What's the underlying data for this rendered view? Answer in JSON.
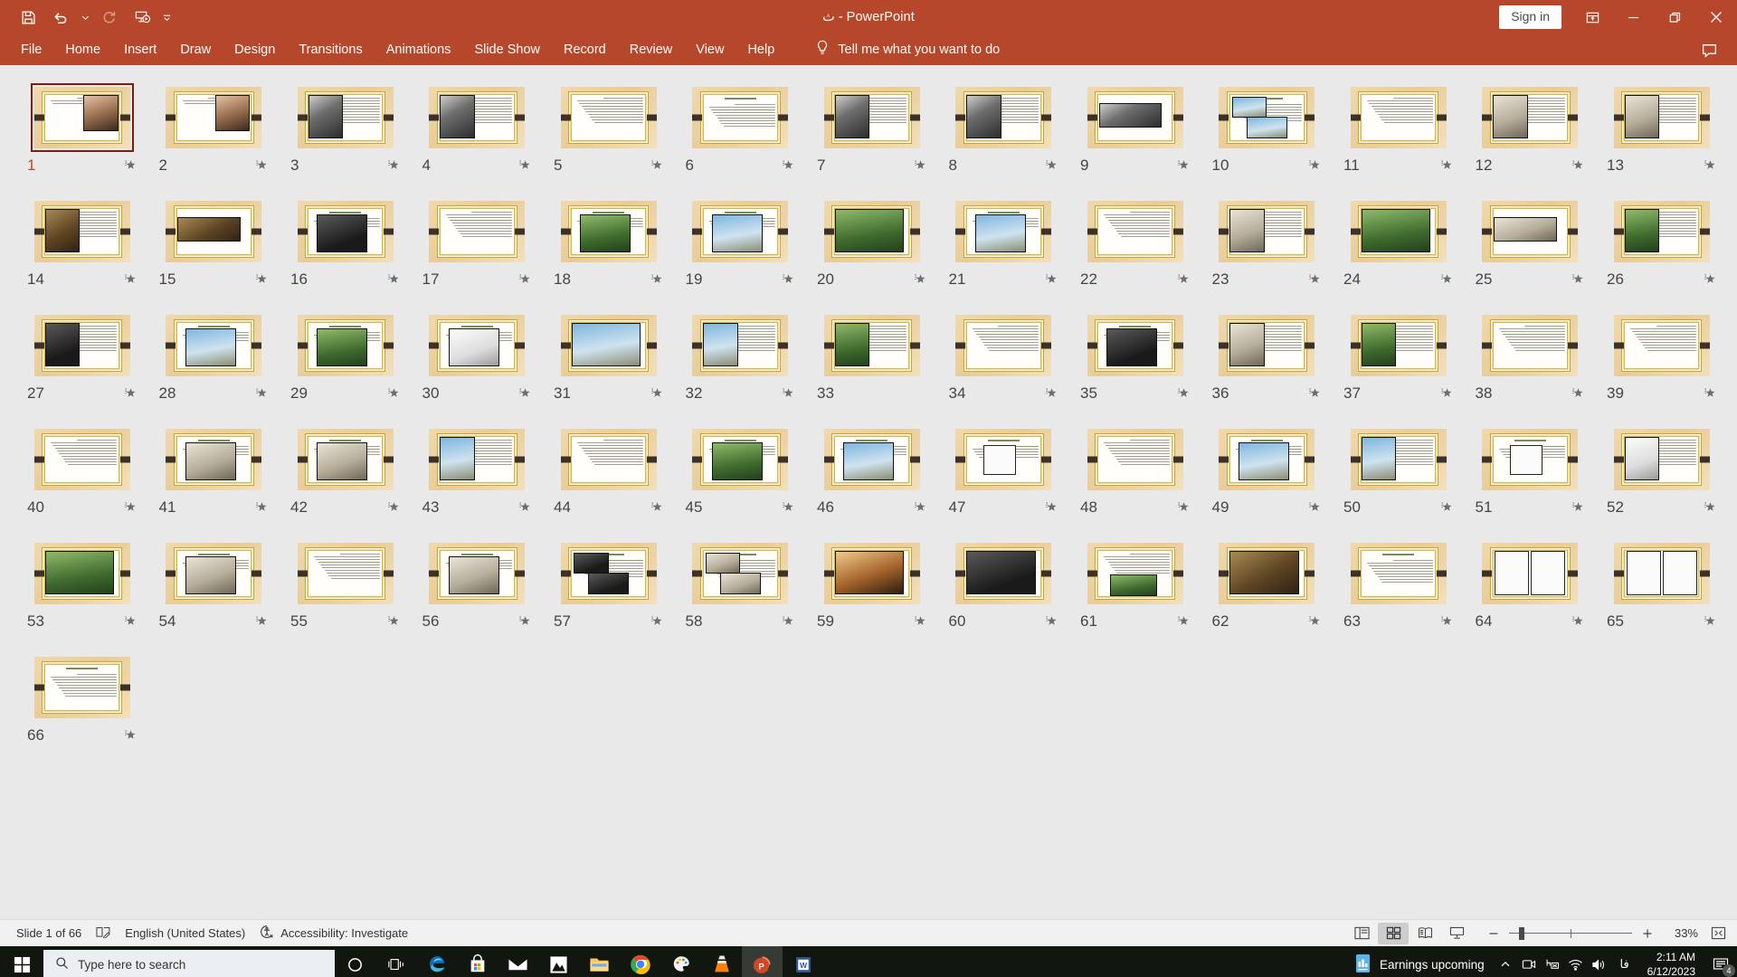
{
  "titlebar": {
    "title": "ث  -  PowerPoint",
    "signin_label": "Sign in",
    "quick_access": [
      {
        "name": "save-icon",
        "label": "Save"
      },
      {
        "name": "undo-icon",
        "label": "Undo"
      },
      {
        "name": "undo-dropdown-caret-icon",
        "label": "Undo options"
      },
      {
        "name": "redo-icon",
        "label": "Redo"
      },
      {
        "name": "start-presentation-icon",
        "label": "Start From Beginning"
      },
      {
        "name": "customize-quick-access-toolbar-icon",
        "label": "Customize Quick Access Toolbar"
      }
    ],
    "window_controls": [
      {
        "name": "ribbon-display-options-icon",
        "label": "Ribbon Display Options"
      },
      {
        "name": "minimize-icon",
        "label": "Minimize"
      },
      {
        "name": "restore-icon",
        "label": "Restore Down"
      },
      {
        "name": "close-icon",
        "label": "Close"
      }
    ]
  },
  "ribbon": {
    "tabs": [
      {
        "label": "File"
      },
      {
        "label": "Home"
      },
      {
        "label": "Insert"
      },
      {
        "label": "Draw"
      },
      {
        "label": "Design"
      },
      {
        "label": "Transitions"
      },
      {
        "label": "Animations"
      },
      {
        "label": "Slide Show"
      },
      {
        "label": "Record"
      },
      {
        "label": "Review"
      },
      {
        "label": "View"
      },
      {
        "label": "Help"
      }
    ],
    "tellme_label": "Tell me what you want to do",
    "comments_label": "Comments"
  },
  "statusbar": {
    "slide_counter": "Slide 1 of 66",
    "notes_label": "Notes",
    "language": "English (United States)",
    "accessibility": "Accessibility: Investigate",
    "views": [
      {
        "name": "normal-view-button",
        "label": "Normal",
        "active": false
      },
      {
        "name": "slide-sorter-view-button",
        "label": "Slide Sorter",
        "active": true
      },
      {
        "name": "reading-view-button",
        "label": "Reading View",
        "active": false
      },
      {
        "name": "slide-show-view-button",
        "label": "Slide Show",
        "active": false
      }
    ],
    "zoom_out_label": "Zoom Out",
    "zoom_in_label": "Zoom In",
    "zoom_value": "33%",
    "fit_label": "Fit slide to current window"
  },
  "taskbar": {
    "search_placeholder": "Type here to search",
    "start_label": "Start",
    "icons": [
      {
        "name": "cortana-icon",
        "label": "Cortana"
      },
      {
        "name": "task-view-icon",
        "label": "Task View"
      },
      {
        "name": "edge-icon",
        "label": "Microsoft Edge"
      },
      {
        "name": "microsoft-store-icon",
        "label": "Microsoft Store"
      },
      {
        "name": "mail-icon",
        "label": "Mail"
      },
      {
        "name": "photos-icon",
        "label": "Photos"
      },
      {
        "name": "file-explorer-icon",
        "label": "File Explorer"
      },
      {
        "name": "chrome-icon",
        "label": "Google Chrome"
      },
      {
        "name": "paint-icon",
        "label": "Paint"
      },
      {
        "name": "vlc-icon",
        "label": "VLC media player"
      },
      {
        "name": "powerpoint-icon",
        "label": "PowerPoint"
      },
      {
        "name": "word-icon",
        "label": "Word"
      }
    ],
    "news_label": "Earnings upcoming",
    "tray": [
      {
        "name": "show-hidden-icons-icon",
        "label": "Show hidden icons"
      },
      {
        "name": "camera-privacy-icon",
        "label": "Camera in use"
      },
      {
        "name": "network-disconnected-icon",
        "label": "Network"
      },
      {
        "name": "wifi-icon",
        "label": "Wi-Fi"
      },
      {
        "name": "volume-icon",
        "label": "Speakers"
      },
      {
        "name": "language-indicator",
        "label": "فا"
      }
    ],
    "time": "2:11 AM",
    "date": "6/12/2023",
    "notification_count": "4",
    "notification_label": "Notifications"
  },
  "sorter": {
    "selected_slide": 1,
    "total": 66,
    "slides": [
      {
        "n": "1",
        "star": true,
        "layout": "title-photo-right"
      },
      {
        "n": "2",
        "star": true,
        "layout": "title-photo-right"
      },
      {
        "n": "3",
        "star": true,
        "layout": "photo-left-bw"
      },
      {
        "n": "4",
        "star": true,
        "layout": "photo-left-bw"
      },
      {
        "n": "5",
        "star": true,
        "layout": "text-only"
      },
      {
        "n": "6",
        "star": true,
        "layout": "text-title"
      },
      {
        "n": "7",
        "star": true,
        "layout": "photo-left-bw"
      },
      {
        "n": "8",
        "star": true,
        "layout": "photo-left-bw"
      },
      {
        "n": "9",
        "star": true,
        "layout": "photo-wide-bw"
      },
      {
        "n": "10",
        "star": true,
        "layout": "photos-two-sky"
      },
      {
        "n": "11",
        "star": true,
        "layout": "text-only"
      },
      {
        "n": "12",
        "star": true,
        "layout": "photo-left-stone"
      },
      {
        "n": "13",
        "star": true,
        "layout": "photo-left-stone"
      },
      {
        "n": "14",
        "star": true,
        "layout": "photo-left-sepia"
      },
      {
        "n": "15",
        "star": true,
        "layout": "photo-wide-sepia"
      },
      {
        "n": "16",
        "star": true,
        "layout": "photo-center-drk"
      },
      {
        "n": "17",
        "star": true,
        "layout": "text-only"
      },
      {
        "n": "18",
        "star": true,
        "layout": "photo-center-grn"
      },
      {
        "n": "19",
        "star": true,
        "layout": "photo-center-sky"
      },
      {
        "n": "20",
        "star": true,
        "layout": "photo-full-grn"
      },
      {
        "n": "21",
        "star": true,
        "layout": "photo-center-sky"
      },
      {
        "n": "22",
        "star": true,
        "layout": "text-only"
      },
      {
        "n": "23",
        "star": true,
        "layout": "photo-left-stone"
      },
      {
        "n": "24",
        "star": true,
        "layout": "photo-full-grn"
      },
      {
        "n": "25",
        "star": true,
        "layout": "photo-wide-stone"
      },
      {
        "n": "26",
        "star": true,
        "layout": "photo-left-grn"
      },
      {
        "n": "27",
        "star": true,
        "layout": "photo-left-drk"
      },
      {
        "n": "28",
        "star": true,
        "layout": "photo-center-sky"
      },
      {
        "n": "29",
        "star": true,
        "layout": "photo-center-grn"
      },
      {
        "n": "30",
        "star": true,
        "layout": "photo-center-wht"
      },
      {
        "n": "31",
        "star": true,
        "layout": "photo-full-sky"
      },
      {
        "n": "32",
        "star": true,
        "layout": "photo-left-sky"
      },
      {
        "n": "33",
        "star": false,
        "layout": "photo-left-grn"
      },
      {
        "n": "34",
        "star": true,
        "layout": "text-only"
      },
      {
        "n": "35",
        "star": true,
        "layout": "photo-center-drk"
      },
      {
        "n": "36",
        "star": true,
        "layout": "photo-left-stone"
      },
      {
        "n": "37",
        "star": true,
        "layout": "photo-left-grn"
      },
      {
        "n": "38",
        "star": true,
        "layout": "text-only"
      },
      {
        "n": "39",
        "star": true,
        "layout": "text-only"
      },
      {
        "n": "40",
        "star": true,
        "layout": "text-only"
      },
      {
        "n": "41",
        "star": true,
        "layout": "photo-center-stn"
      },
      {
        "n": "42",
        "star": true,
        "layout": "photo-center-stn"
      },
      {
        "n": "43",
        "star": true,
        "layout": "photo-left-sky"
      },
      {
        "n": "44",
        "star": true,
        "layout": "text-only"
      },
      {
        "n": "45",
        "star": true,
        "layout": "photo-center-grn"
      },
      {
        "n": "46",
        "star": true,
        "layout": "photo-center-sky"
      },
      {
        "n": "47",
        "star": true,
        "layout": "diagram-sketch"
      },
      {
        "n": "48",
        "star": true,
        "layout": "text-only"
      },
      {
        "n": "49",
        "star": true,
        "layout": "photo-center-sky"
      },
      {
        "n": "50",
        "star": true,
        "layout": "photo-left-sky"
      },
      {
        "n": "51",
        "star": true,
        "layout": "diagram-sketch"
      },
      {
        "n": "52",
        "star": true,
        "layout": "photo-left-wht"
      },
      {
        "n": "53",
        "star": true,
        "layout": "photo-full-grn"
      },
      {
        "n": "54",
        "star": true,
        "layout": "photo-center-stn"
      },
      {
        "n": "55",
        "star": true,
        "layout": "text-only"
      },
      {
        "n": "56",
        "star": true,
        "layout": "photo-center-stn"
      },
      {
        "n": "57",
        "star": true,
        "layout": "photos-two-drk"
      },
      {
        "n": "58",
        "star": true,
        "layout": "photos-two-stn"
      },
      {
        "n": "59",
        "star": true,
        "layout": "photo-full-warm"
      },
      {
        "n": "60",
        "star": true,
        "layout": "photo-full-drk"
      },
      {
        "n": "61",
        "star": true,
        "layout": "photo-bottom-grn"
      },
      {
        "n": "62",
        "star": true,
        "layout": "photo-full-sepia"
      },
      {
        "n": "63",
        "star": true,
        "layout": "text-title"
      },
      {
        "n": "64",
        "star": true,
        "layout": "sketch-pair"
      },
      {
        "n": "65",
        "star": true,
        "layout": "sketch-pair"
      },
      {
        "n": "66",
        "star": true,
        "layout": "text-title"
      }
    ]
  }
}
